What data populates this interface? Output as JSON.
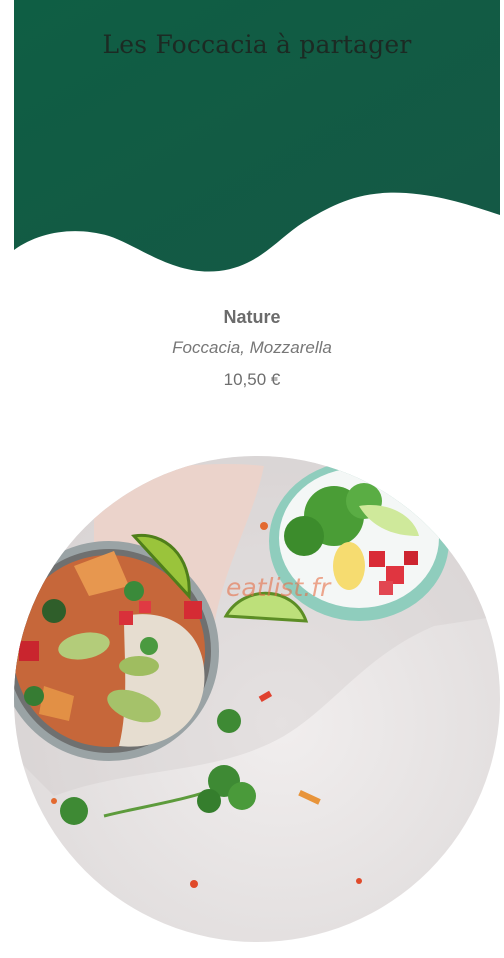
{
  "header": {
    "title": "Les Foccacia à partager",
    "background_color": "#0f5b43"
  },
  "menu_item": {
    "name": "Nature",
    "description": "Foccacia, Mozzarella",
    "price": "10,50 €"
  },
  "image": {
    "watermark": "eatlist.fr"
  }
}
